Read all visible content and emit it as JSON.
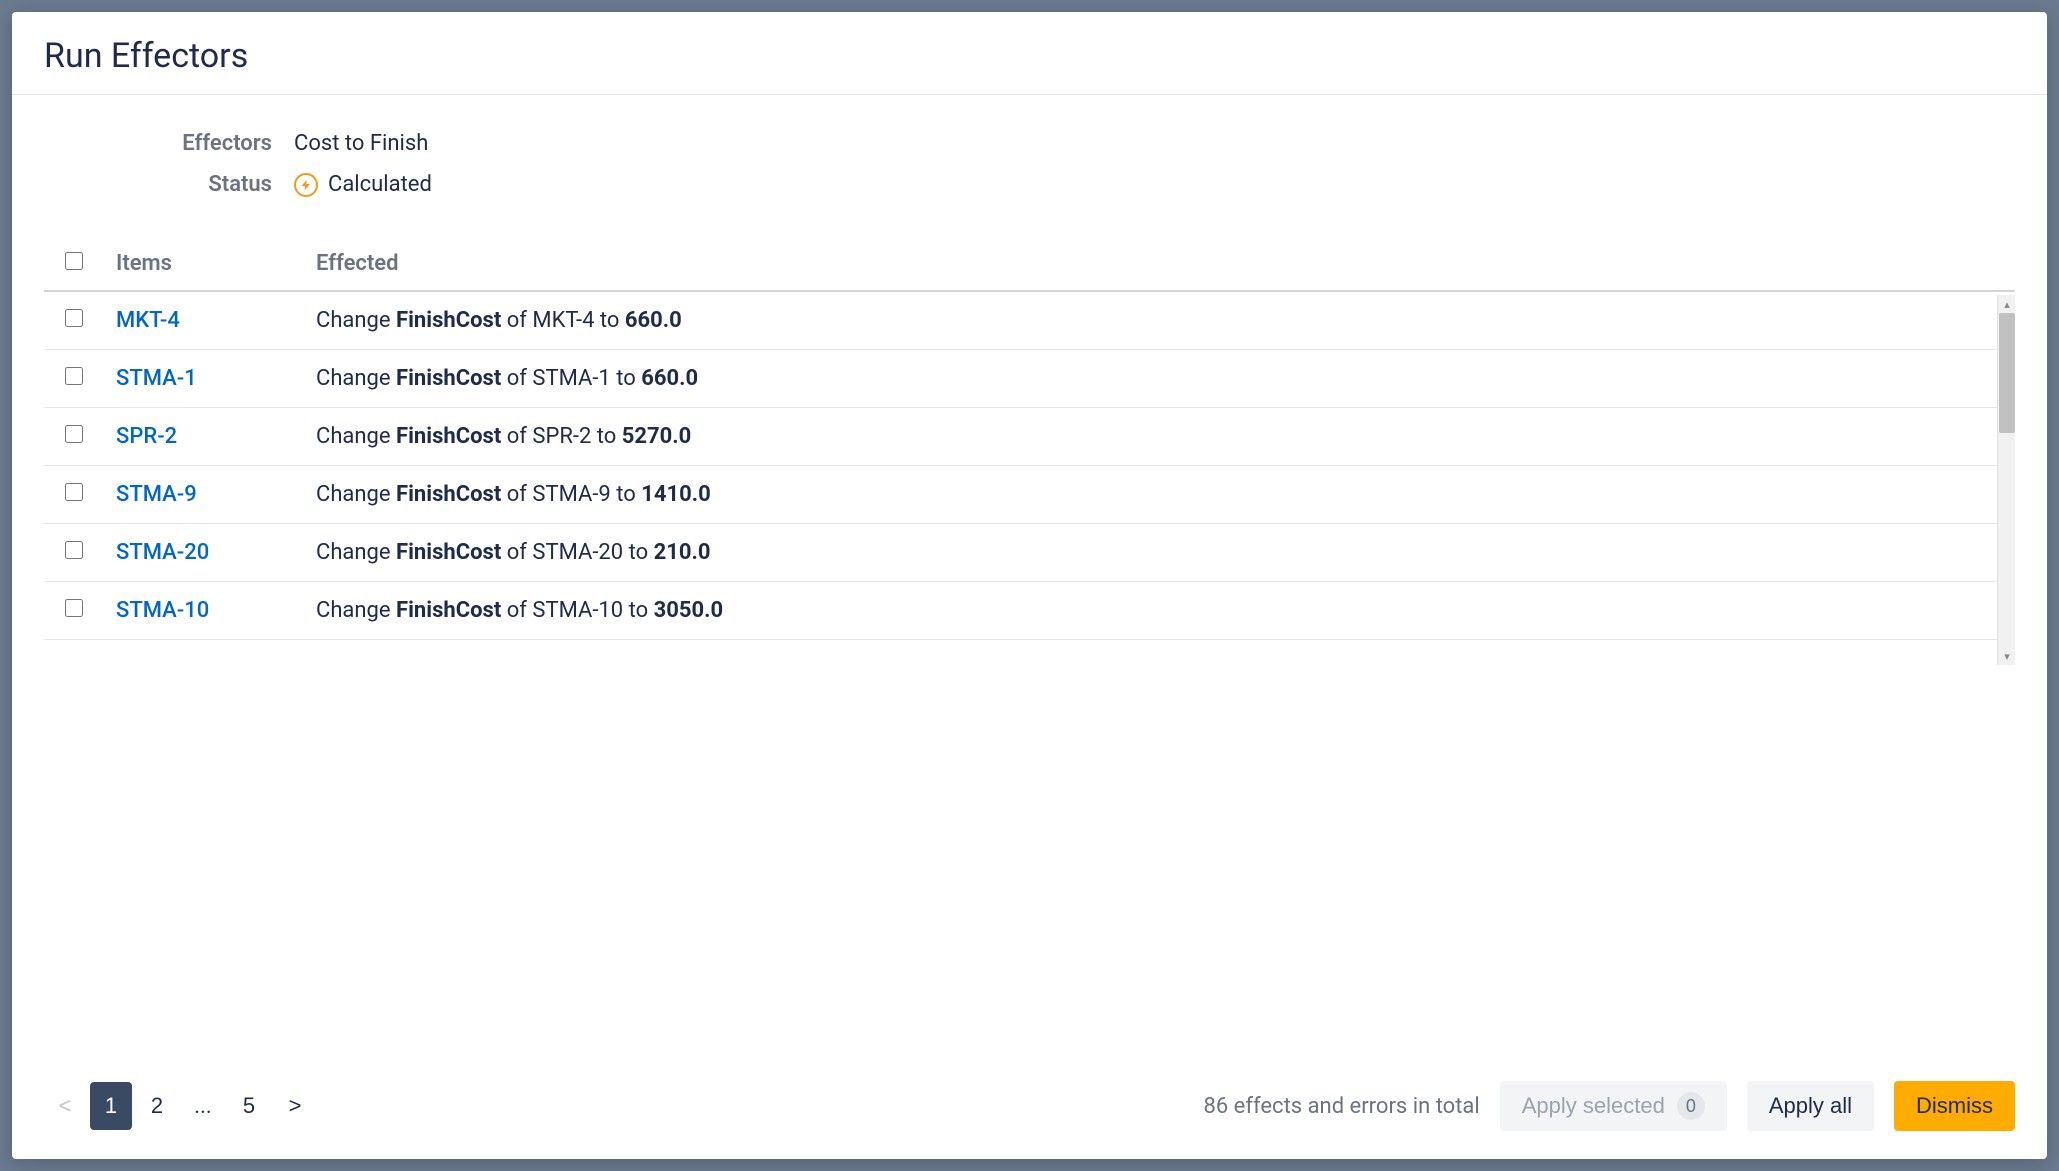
{
  "modal": {
    "title": "Run Effectors"
  },
  "info": {
    "effectors_label": "Effectors",
    "effectors_value": "Cost to Finish",
    "status_label": "Status",
    "status_value": "Calculated"
  },
  "table": {
    "header_checkbox": "",
    "header_items": "Items",
    "header_effected": "Effected",
    "rows": [
      {
        "item": "MKT-4",
        "effect_prefix": "Change ",
        "effect_field": "FinishCost",
        "effect_of": " of MKT-4 to ",
        "effect_value": "660.0"
      },
      {
        "item": "STMA-1",
        "effect_prefix": "Change ",
        "effect_field": "FinishCost",
        "effect_of": " of STMA-1 to ",
        "effect_value": "660.0"
      },
      {
        "item": "SPR-2",
        "effect_prefix": "Change ",
        "effect_field": "FinishCost",
        "effect_of": " of SPR-2 to ",
        "effect_value": "5270.0"
      },
      {
        "item": "STMA-9",
        "effect_prefix": "Change ",
        "effect_field": "FinishCost",
        "effect_of": " of STMA-9 to ",
        "effect_value": "1410.0"
      },
      {
        "item": "STMA-20",
        "effect_prefix": "Change ",
        "effect_field": "FinishCost",
        "effect_of": " of STMA-20 to ",
        "effect_value": "210.0"
      },
      {
        "item": "STMA-10",
        "effect_prefix": "Change ",
        "effect_field": "FinishCost",
        "effect_of": " of STMA-10 to ",
        "effect_value": "3050.0"
      }
    ]
  },
  "pagination": {
    "prev": "<",
    "page1": "1",
    "page2": "2",
    "ellipsis": "...",
    "page5": "5",
    "next": ">"
  },
  "footer": {
    "total_text": "86 effects and errors in total",
    "apply_selected_label": "Apply selected",
    "apply_selected_count": "0",
    "apply_all_label": "Apply all",
    "dismiss_label": "Dismiss"
  }
}
